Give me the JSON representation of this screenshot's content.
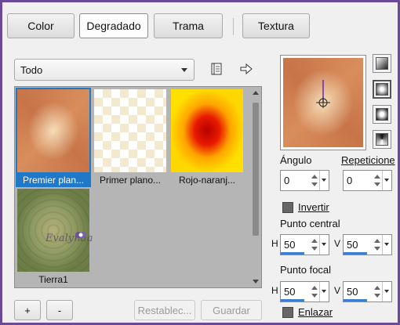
{
  "tabs": [
    {
      "label": "Color",
      "active": false
    },
    {
      "label": "Degradado",
      "active": true
    },
    {
      "label": "Trama",
      "active": false
    },
    {
      "label": "Textura",
      "active": false
    }
  ],
  "category": {
    "value": "Todo"
  },
  "gallery": {
    "items": [
      {
        "label": "Premier plan...",
        "selected": true
      },
      {
        "label": "Primer plano...",
        "selected": false
      },
      {
        "label": "Rojo-naranj...",
        "selected": false
      },
      {
        "label": "Tierra1",
        "selected": false
      }
    ],
    "watermark": "Evalynda"
  },
  "buttons": {
    "add": "+",
    "remove": "-",
    "reset": "Restablec...",
    "save": "Guardar"
  },
  "angle": {
    "label": "Ángulo",
    "value": "0"
  },
  "repeats": {
    "label": "Repeticione",
    "value": "0"
  },
  "invert": {
    "label": "Invertir",
    "checked": false
  },
  "center_point": {
    "label": "Punto central",
    "h_label": "H",
    "h": "50",
    "v_label": "V",
    "v": "50"
  },
  "focal_point": {
    "label": "Punto focal",
    "h_label": "H",
    "h": "50",
    "v_label": "V",
    "v": "50"
  },
  "link": {
    "label": "Enlazar",
    "checked": false
  },
  "colors": {
    "accent": "#1f78c8",
    "frame": "#6a4a96",
    "gradient_outer": "#c9774a",
    "gradient_inner": "#f6dcb4"
  }
}
